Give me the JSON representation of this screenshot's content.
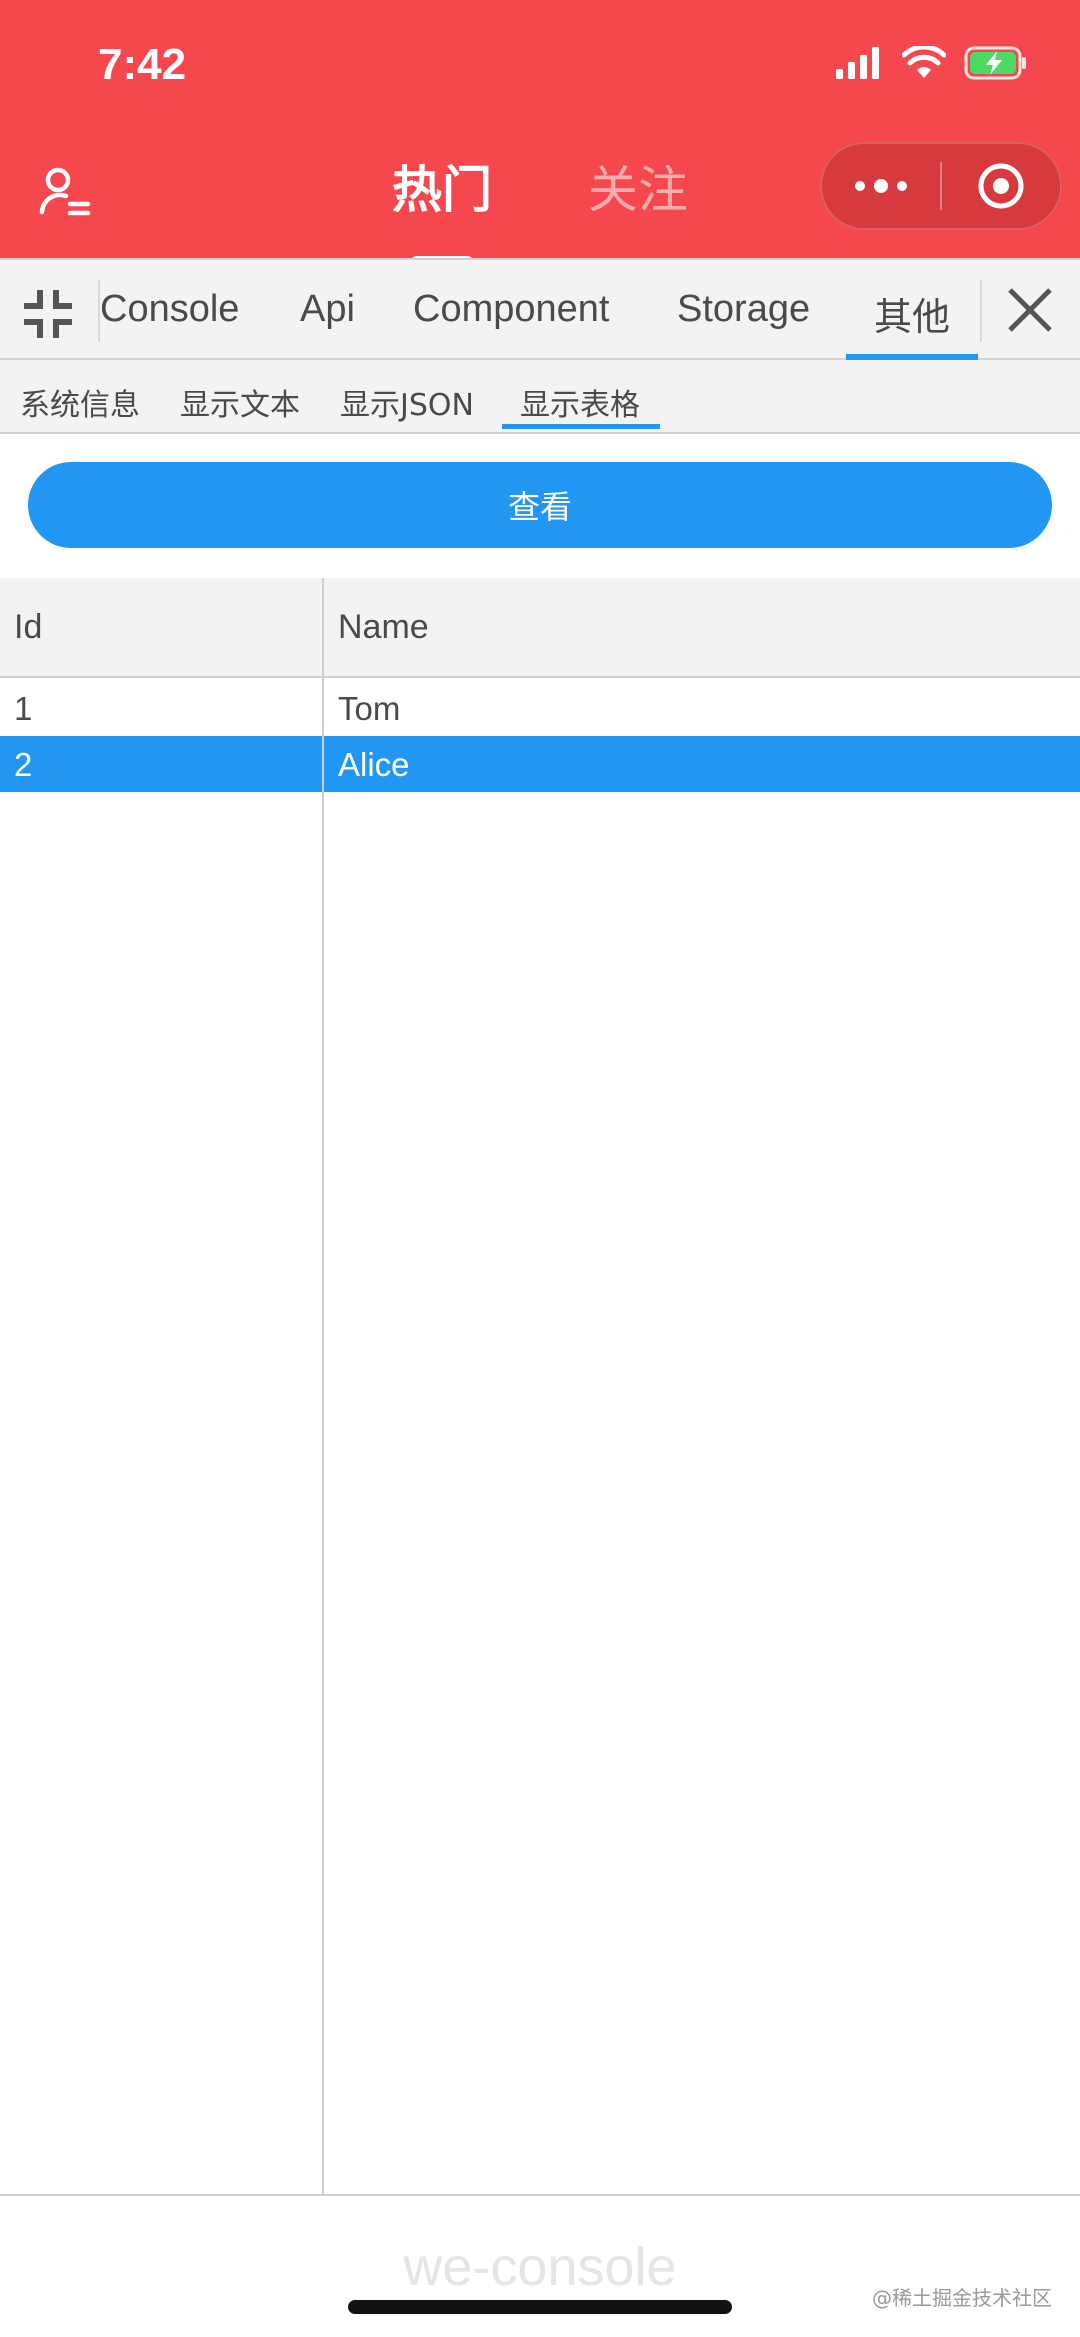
{
  "status_bar": {
    "time": "7:42"
  },
  "header": {
    "tabs": [
      {
        "label": "热门",
        "active": true
      },
      {
        "label": "关注",
        "active": false
      }
    ],
    "accent_color": "#f5474e"
  },
  "console": {
    "tabs": [
      {
        "label": "Console"
      },
      {
        "label": "Api"
      },
      {
        "label": "Component"
      },
      {
        "label": "Storage"
      },
      {
        "label": "其他",
        "active": true
      }
    ],
    "sub_tabs": [
      {
        "label": "系统信息"
      },
      {
        "label": "显示文本"
      },
      {
        "label": "显示JSON"
      },
      {
        "label": "显示表格",
        "active": true
      }
    ],
    "accent_color": "#2196f3"
  },
  "view_button": {
    "label": "查看"
  },
  "table": {
    "columns": [
      "Id",
      "Name"
    ],
    "rows": [
      {
        "id": "1",
        "name": "Tom",
        "selected": false
      },
      {
        "id": "2",
        "name": "Alice",
        "selected": true
      }
    ]
  },
  "footer": {
    "brand": "we-console",
    "watermark": "@稀土掘金技术社区"
  }
}
